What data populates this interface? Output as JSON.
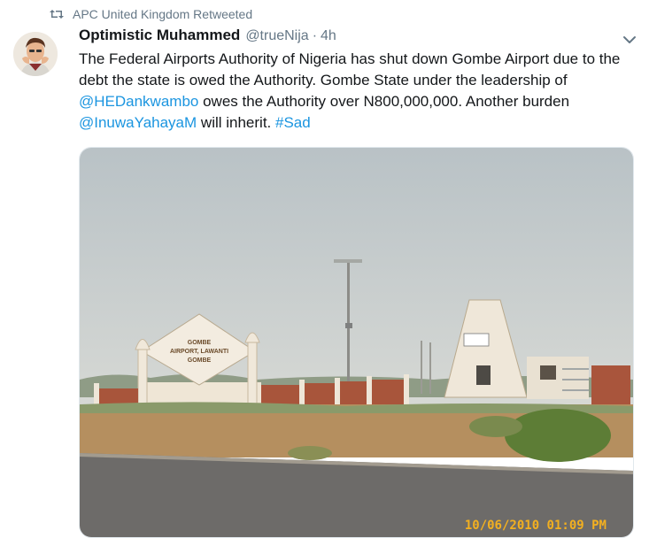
{
  "retweet": {
    "text": "APC United Kingdom Retweeted",
    "icon": "retweet-icon"
  },
  "tweet": {
    "author_name": "Optimistic Muhammed",
    "handle": "@trueNija",
    "separator": "·",
    "time": "4h",
    "text_parts": {
      "p1": "The Federal Airports Authority of Nigeria has shut down  Gombe Airport due to the debt the state is owed the Authority. Gombe State under the leadership of ",
      "mention1": "@HEDankwambo",
      "p2": " owes the Authority over N800,000,000. Another burden ",
      "mention2": "@InuwaYahayaM",
      "p3": " will inherit. ",
      "hashtag": "#Sad"
    },
    "photo": {
      "sign_line1": "GOMBE",
      "sign_line2": "AIRPORT, LAWANTI",
      "sign_line3": "GOMBE",
      "timestamp": "10/06/2010 01:09 PM"
    }
  },
  "colors": {
    "link": "#1b95e0",
    "secondary": "#657786",
    "stamp": "#f3b020"
  }
}
